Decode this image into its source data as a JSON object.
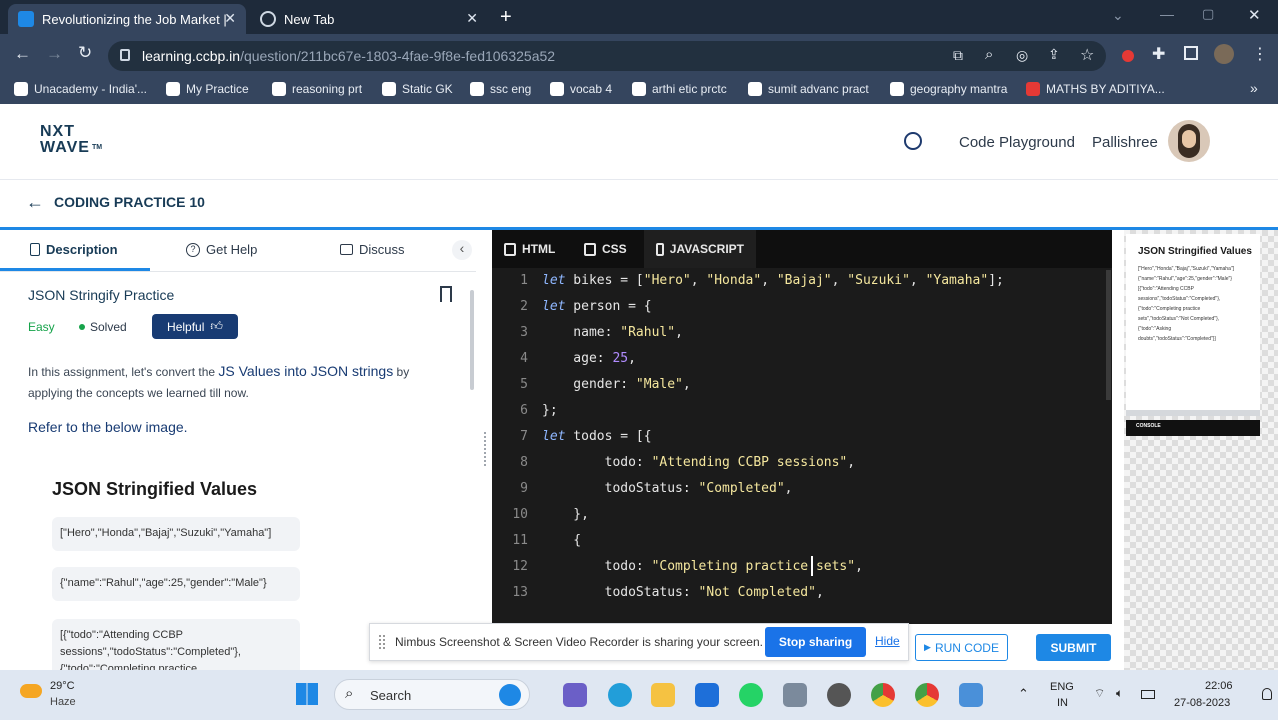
{
  "browser": {
    "tabs": [
      {
        "title": "Revolutionizing the Job Market |",
        "active": true
      },
      {
        "title": "New Tab",
        "active": false
      }
    ],
    "new_tab_icon": "plus-icon",
    "address": {
      "domain": "learning.ccbp.in",
      "path": "/question/211bc67e-1803-4fae-9f8e-fed106325a52"
    },
    "bookmarks": [
      {
        "label": "Unacademy - India'..."
      },
      {
        "label": "My Practice"
      },
      {
        "label": "reasoning prt"
      },
      {
        "label": "Static GK"
      },
      {
        "label": "ssc eng"
      },
      {
        "label": "vocab 4"
      },
      {
        "label": "arthi etic prctc"
      },
      {
        "label": "sumit advanc pract"
      },
      {
        "label": "geography mantra"
      },
      {
        "label": "MATHS BY ADITIYA..."
      }
    ],
    "more_bookmarks": "»"
  },
  "app": {
    "logo_top": "NXT",
    "logo_bottom": "WAVE",
    "logo_tm": "TM",
    "code_playground": "Code Playground",
    "username": "Pallishree",
    "breadcrumb": "CODING PRACTICE 10"
  },
  "left": {
    "tabs": [
      "Description",
      "Get Help",
      "Discuss"
    ],
    "collapse": "‹",
    "title": "JSON Stringify Practice",
    "difficulty": "Easy",
    "status": "Solved",
    "helpful": "Helpful",
    "desc_pre": "In this assignment, let's convert the ",
    "desc_link": "JS Values into JSON strings",
    "desc_mid": " by",
    "desc_post": "applying the concepts we learned till now.",
    "refer": "Refer to the below image.",
    "image_title": "JSON Stringified Values",
    "image_rows": [
      "[\"Hero\",\"Honda\",\"Bajaj\",\"Suzuki\",\"Yamaha\"]",
      "{\"name\":\"Rahul\",\"age\":25,\"gender\":\"Male\"}",
      "[{\"todo\":\"Attending CCBP",
      "sessions\",\"todoStatus\":\"Completed\"},",
      "{\"todo\":\"Completing practice"
    ]
  },
  "editor": {
    "tabs": [
      "HTML",
      "CSS",
      "JAVASCRIPT"
    ],
    "lines": [
      {
        "n": "1",
        "t": "bikes"
      },
      {
        "n": "2",
        "t": "person"
      },
      {
        "n": "3",
        "t": "name"
      },
      {
        "n": "4",
        "t": "age"
      },
      {
        "n": "5",
        "t": "gender"
      },
      {
        "n": "6",
        "t": "close1"
      },
      {
        "n": "7",
        "t": "todos"
      },
      {
        "n": "8",
        "t": "todo1"
      },
      {
        "n": "9",
        "t": "status1"
      },
      {
        "n": "10",
        "t": "close2"
      },
      {
        "n": "11",
        "t": "open3"
      },
      {
        "n": "12",
        "t": "todo2"
      },
      {
        "n": "13",
        "t": "status2"
      }
    ],
    "code": {
      "l1": {
        "kw": "let",
        "a": " bikes = [",
        "s1": "\"Hero\"",
        "c1": ", ",
        "s2": "\"Honda\"",
        "c2": ", ",
        "s3": "\"Bajaj\"",
        "c3": ", ",
        "s4": "\"Suzuki\"",
        "c4": ", ",
        "s5": "\"Yamaha\"",
        "e": "];"
      },
      "l2": {
        "kw": "let",
        "a": " person = {"
      },
      "l3": {
        "a": "    name: ",
        "s": "\"Rahul\"",
        "e": ","
      },
      "l4": {
        "a": "    age: ",
        "n": "25",
        "e": ","
      },
      "l5": {
        "a": "    gender: ",
        "s": "\"Male\"",
        "e": ","
      },
      "l6": {
        "a": "};"
      },
      "l7": {
        "kw": "let",
        "a": " todos = [{"
      },
      "l8": {
        "a": "        todo: ",
        "s": "\"Attending CCBP sessions\"",
        "e": ","
      },
      "l9": {
        "a": "        todoStatus: ",
        "s": "\"Completed\"",
        "e": ","
      },
      "l10": {
        "a": "    },"
      },
      "l11": {
        "a": "    {"
      },
      "l12": {
        "a": "        todo: ",
        "s": "\"Completing practice sets\"",
        "e": ","
      },
      "l13": {
        "a": "        todoStatus: ",
        "s": "\"Not Completed\"",
        "e": ","
      }
    }
  },
  "preview": {
    "title": "JSON Stringified Values",
    "lines": [
      "[\"Hero\",\"Honda\",\"Bajaj\",\"Suzuki\",\"Yamaha\"]",
      "{\"name\":\"Rahul\",\"age\":25,\"gender\":\"Male\"}",
      "[{\"todo\":\"Attending CCBP",
      "sessions\",\"todoStatus\":\"Completed\"},",
      "{\"todo\":\"Completing practice",
      "sets\",\"todoStatus\":\"Not Completed\"},",
      "{\"todo\":\"Asking",
      "doubts\",\"todoStatus\":\"Completed\"}]"
    ],
    "console": "CONSOLE"
  },
  "sharing": {
    "message": "Nimbus Screenshot & Screen Video Recorder is sharing your screen.",
    "stop": "Stop sharing",
    "hide": "Hide"
  },
  "actions": {
    "run": "RUN CODE",
    "submit": "SUBMIT"
  },
  "taskbar": {
    "temp": "29°C",
    "weather": "Haze",
    "search": "Search",
    "lang_top": "ENG",
    "lang_bottom": "IN",
    "time": "22:06",
    "date": "27-08-2023"
  },
  "colors": {
    "accent": "#1e88e5",
    "brand": "#183b56",
    "editor_bg": "#1b1b1b",
    "string": "#f5e79e",
    "keyword": "#8fb7ff",
    "solved": "#16a34a"
  }
}
